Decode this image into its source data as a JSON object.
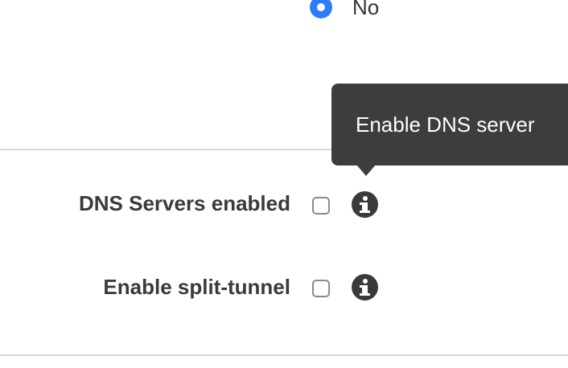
{
  "radio_option": {
    "label": "No",
    "selected": true
  },
  "fields": {
    "dns_servers": {
      "label": "DNS Servers enabled",
      "checked": false,
      "info_icon": "info-circle-icon"
    },
    "split_tunnel": {
      "label": "Enable split-tunnel",
      "checked": false,
      "info_icon": "info-circle-icon"
    }
  },
  "tooltip": {
    "text": "Enable DNS server"
  },
  "colors": {
    "radio_accent": "#2e7cf6",
    "tooltip_bg": "#3d3d3d",
    "label_text": "#3a3a3a",
    "divider": "#d6d6d6"
  }
}
